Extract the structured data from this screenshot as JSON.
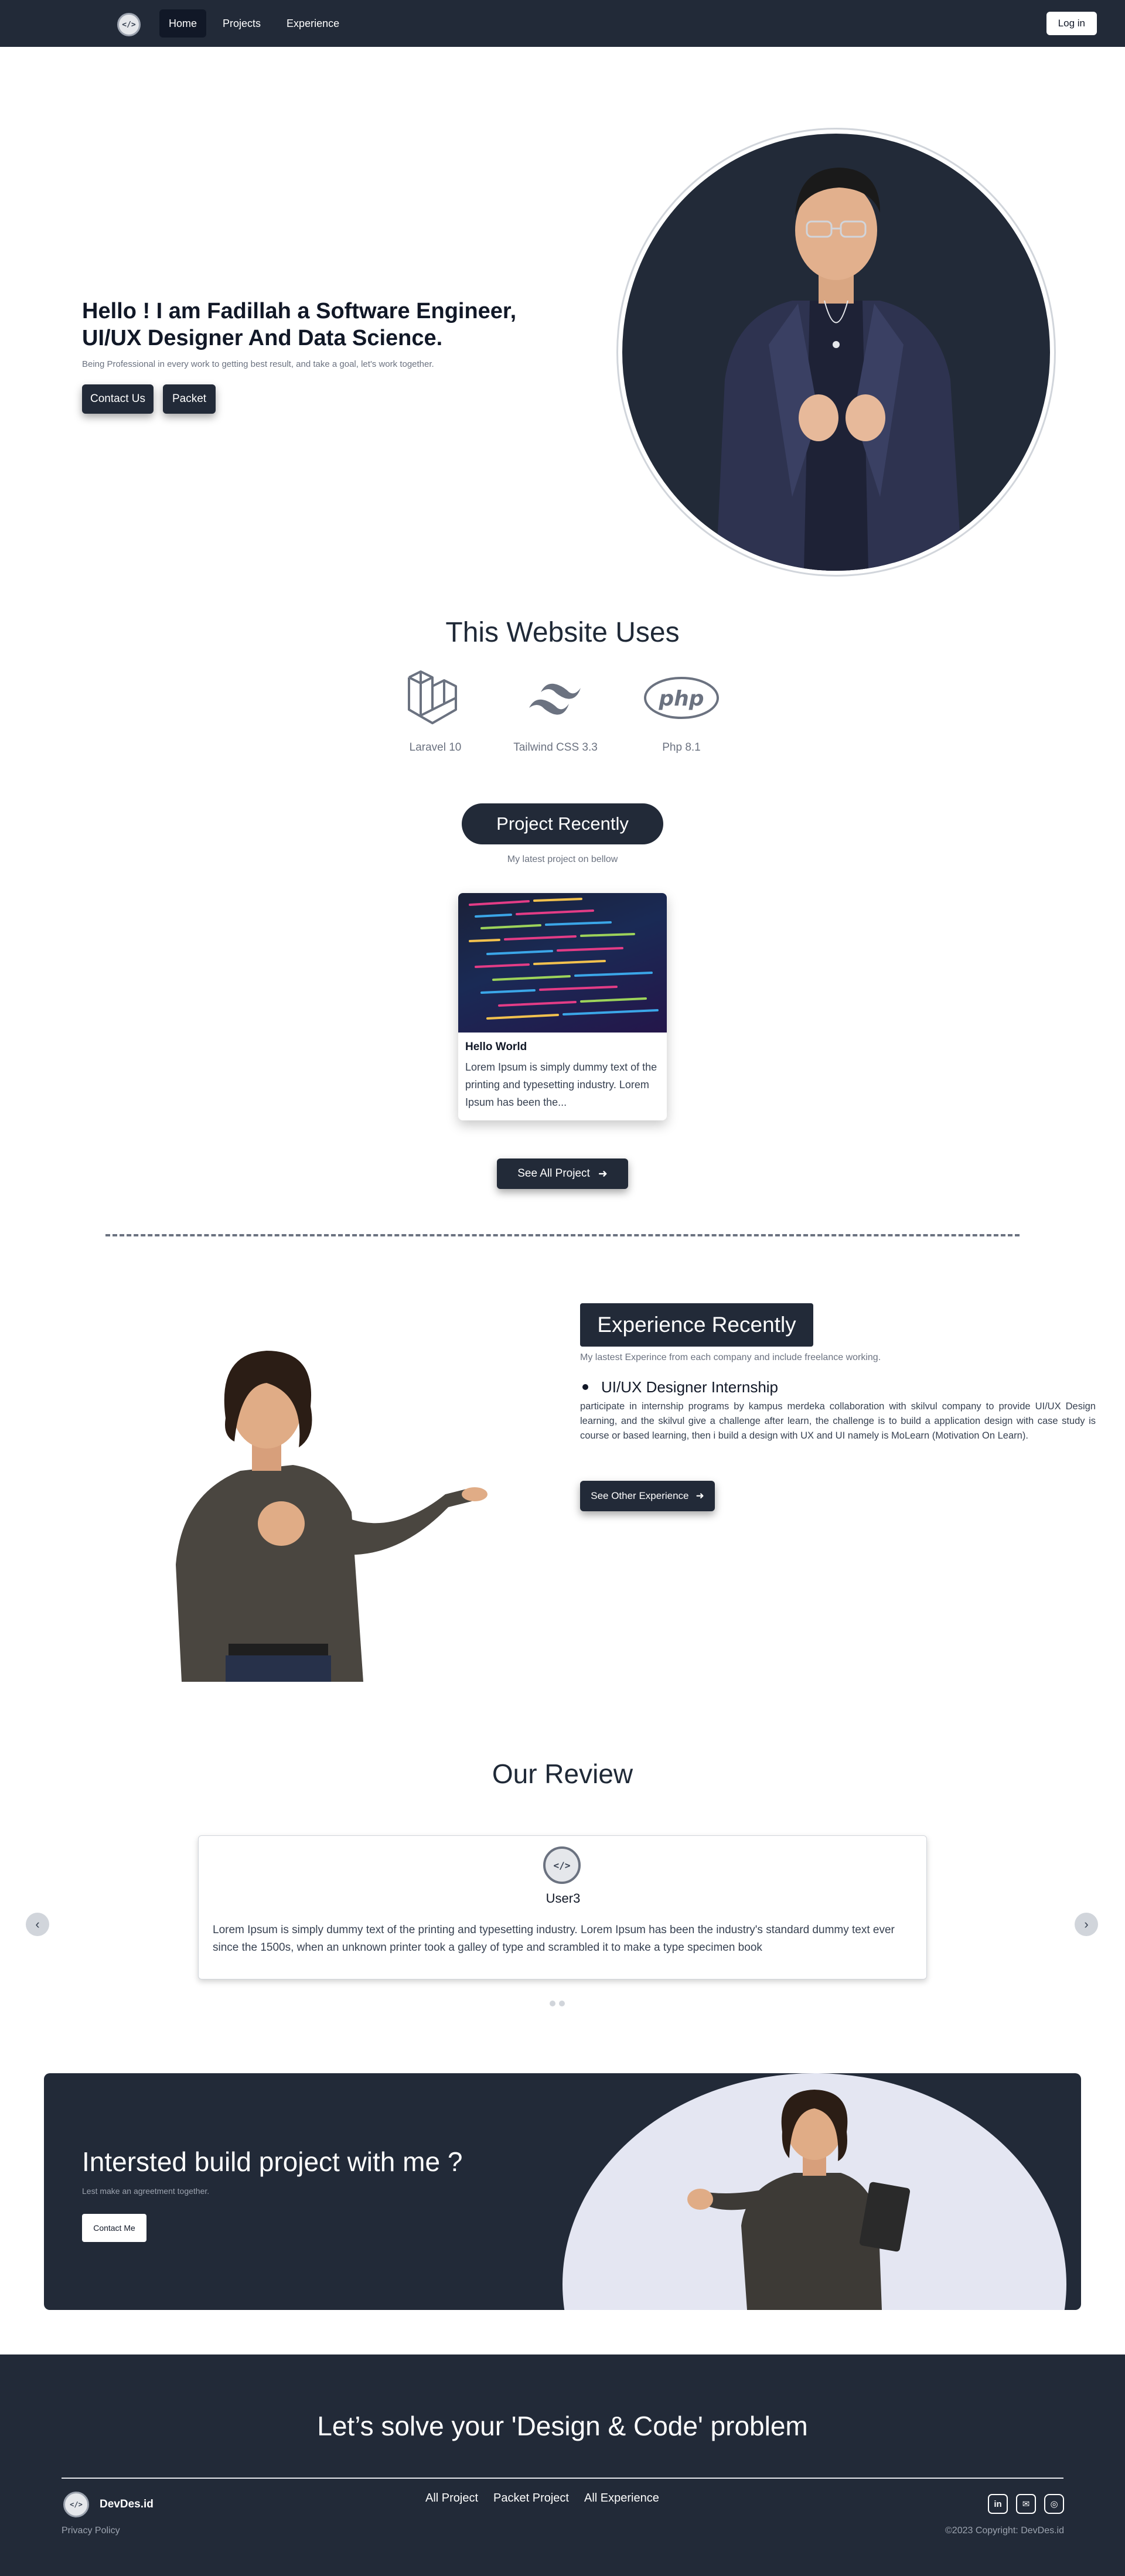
{
  "nav": {
    "logo_text": "</>",
    "links": [
      "Home",
      "Projects",
      "Experience"
    ],
    "login_label": "Log in"
  },
  "hero": {
    "title": "Hello ! I am Fadillah a Software Engineer, UI/UX Designer And Data Science.",
    "subtitle": "Being Professional in every work to getting best result, and take a goal, let's work together.",
    "btn_contact": "Contact Us",
    "btn_packet": "Packet"
  },
  "uses": {
    "title": "This Website Uses",
    "items": [
      {
        "icon": "laravel-icon",
        "label": "Laravel 10"
      },
      {
        "icon": "tailwind-icon",
        "label": "Tailwind CSS 3.3"
      },
      {
        "icon": "php-icon",
        "label": "Php 8.1",
        "logo_text": "php"
      }
    ]
  },
  "projects": {
    "heading": "Project Recently",
    "subtitle": "My latest project on bellow",
    "cards": [
      {
        "title": "Hello World",
        "body": "Lorem Ipsum is simply dummy text of the printing and typesetting industry. Lorem Ipsum has been the..."
      }
    ],
    "see_all": "See All Project"
  },
  "experience": {
    "heading": "Experience Recently",
    "subtitle": "My lastest Experince from each company and include freelance working.",
    "role": "UI/UX Designer Internship",
    "description": "participate in internship programs by kampus merdeka collaboration with skilvul company to provide UI/UX Design learning, and the skilvul give a challenge after learn, the challenge is to build a application design with case study is course or based learning, then i build a design with UX and UI namely is MoLearn (Motivation On Learn).",
    "button": "See Other Experience"
  },
  "review": {
    "heading": "Our Review",
    "name": "User3",
    "text": "Lorem Ipsum is simply dummy text of the printing and typesetting industry. Lorem Ipsum has been the industry's standard dummy text ever since the 1500s, when an unknown printer took a galley of type and scrambled it to make a type specimen book",
    "avatar_text": "</>"
  },
  "cta": {
    "title": "Intersted build project with me ?",
    "subtitle": "Lest make an agreetment together.",
    "button": "Contact Me"
  },
  "footer": {
    "title": "Let’s solve your 'Design & Code' problem",
    "brand": "DevDes.id",
    "logo_text": "</>",
    "privacy": "Privacy Policy",
    "links": [
      "All Project",
      "Packet Project",
      "All Experience"
    ],
    "copyright": "©2023 Copyright: DevDes.id",
    "social": [
      "linkedin-icon",
      "mail-icon",
      "instagram-icon"
    ],
    "social_text": [
      "in",
      "✉",
      "◎"
    ]
  },
  "colors": {
    "navy": "#222a38",
    "accent_light": "#e4e6f2"
  }
}
